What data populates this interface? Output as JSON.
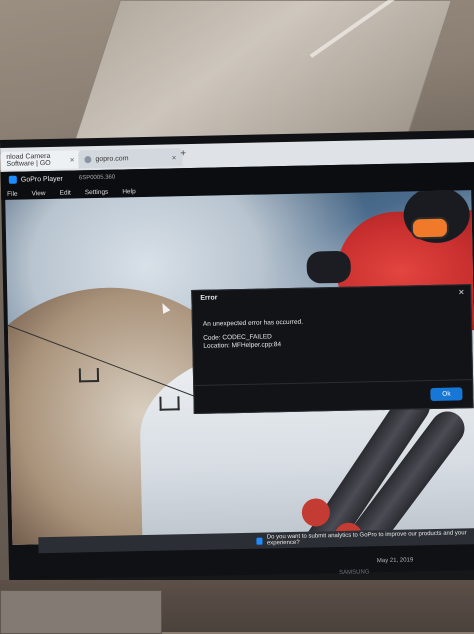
{
  "browser": {
    "tabs": [
      {
        "label": "nload Camera Software | GO"
      },
      {
        "label": "gopro.com"
      }
    ],
    "new_tab": "+"
  },
  "app": {
    "title": "GoPro Player",
    "version": "6SP0005.360",
    "menu": [
      "File",
      "View",
      "Edit",
      "Settings",
      "Help"
    ]
  },
  "dialog": {
    "title": "Error",
    "close": "×",
    "message": "An unexpected error has occurred.",
    "code": "Code: CODEC_FAILED",
    "location": "Location: MFHelper.cpp:84",
    "ok_label": "Ok"
  },
  "taskbar": {
    "notification": "Do you want to submit analytics to GoPro to improve our products and your experience?",
    "date": "May 21, 2019",
    "brand": "SAMSUNG"
  }
}
